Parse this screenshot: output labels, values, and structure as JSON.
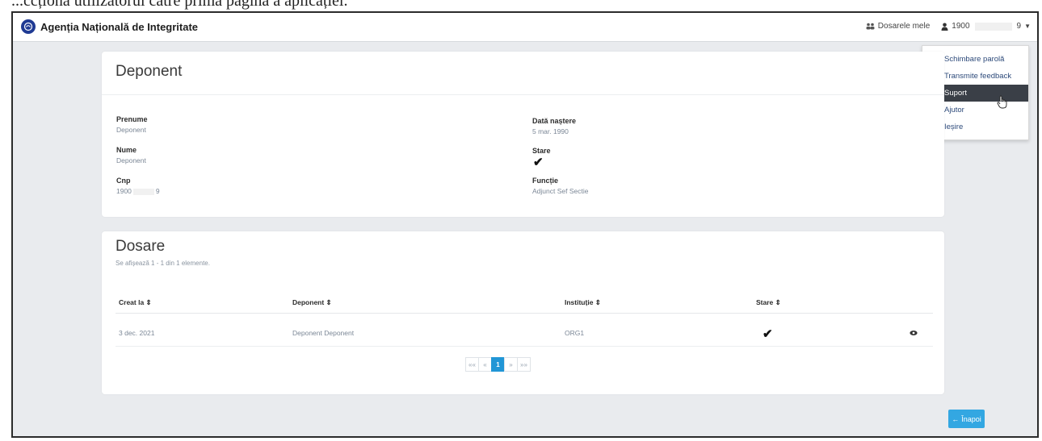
{
  "caption": "...ccționă utilizatorul către prima pagină a aplicației.",
  "navbar": {
    "brand_title": "Agenția Națională de Integritate",
    "my_files_label": "Dosarele mele",
    "user_prefix": "1900",
    "user_suffix": "9"
  },
  "dropdown": {
    "items": [
      {
        "label": "Schimbare parolă",
        "icon": "sign-in-icon"
      },
      {
        "label": "Transmite feedback",
        "icon": "comments-icon"
      },
      {
        "label": "Suport",
        "icon": "support-icon",
        "active": true
      },
      {
        "label": "Ajutor",
        "icon": "info-icon"
      },
      {
        "label": "Ieșire",
        "icon": "sign-out-icon"
      }
    ]
  },
  "profile": {
    "title": "Deponent",
    "first_name_label": "Prenume",
    "first_name": "Deponent",
    "last_name_label": "Nume",
    "last_name": "Deponent",
    "cnp_label": "Cnp",
    "cnp_prefix": "1900",
    "cnp_suffix": "9",
    "birth_label": "Dată naștere",
    "birth_date": "5 mar. 1990",
    "status_label": "Stare",
    "status": "active",
    "function_label": "Funcție",
    "function": "Adjunct Sef Sectie"
  },
  "files": {
    "title": "Dosare",
    "count_text": "Se afișează 1 - 1 din 1 elemente.",
    "columns": [
      "Creat la ⇕",
      "Deponent ⇕",
      "Instituție ⇕",
      "Stare ⇕"
    ],
    "rows": [
      {
        "created": "3 dec. 2021",
        "depositor": "Deponent Deponent",
        "institution": "ORG1",
        "status": "done"
      }
    ],
    "pagination": [
      "««",
      "«",
      "1",
      "»",
      "»»"
    ],
    "current_page": "1"
  },
  "back_label": "Înapoi",
  "colors": {
    "primary": "#2196d6",
    "back_button": "#33a7e2",
    "active_menu": "#3a3f47",
    "brand_logo": "#1f3a93"
  }
}
